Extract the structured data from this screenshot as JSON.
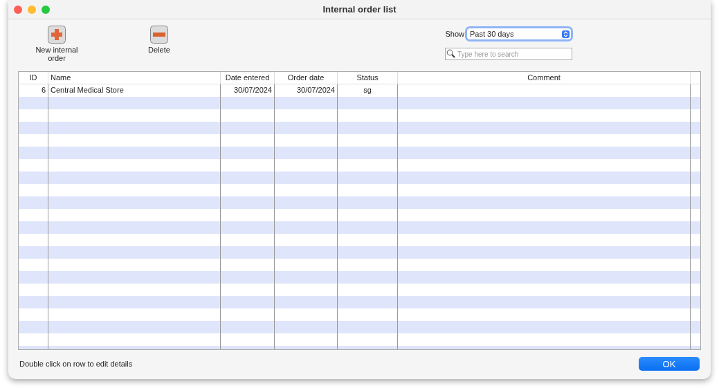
{
  "window": {
    "title": "Internal order list"
  },
  "toolbar": [
    {
      "kind": "add",
      "label": "New internal order"
    },
    {
      "kind": "delete",
      "label": "Delete"
    }
  ],
  "filter": {
    "label": "Show:",
    "value": "Past 30 days"
  },
  "search": {
    "placeholder": "Type here to search"
  },
  "table": {
    "columns": [
      "ID",
      "Name",
      "Date entered",
      "Order date",
      "Status",
      "Comment"
    ],
    "rows": [
      [
        "6",
        "Central Medical Store",
        "30/07/2024",
        "30/07/2024",
        "sg",
        ""
      ]
    ]
  },
  "hint": "Double click on row to edit details",
  "buttons": [
    "OK"
  ]
}
